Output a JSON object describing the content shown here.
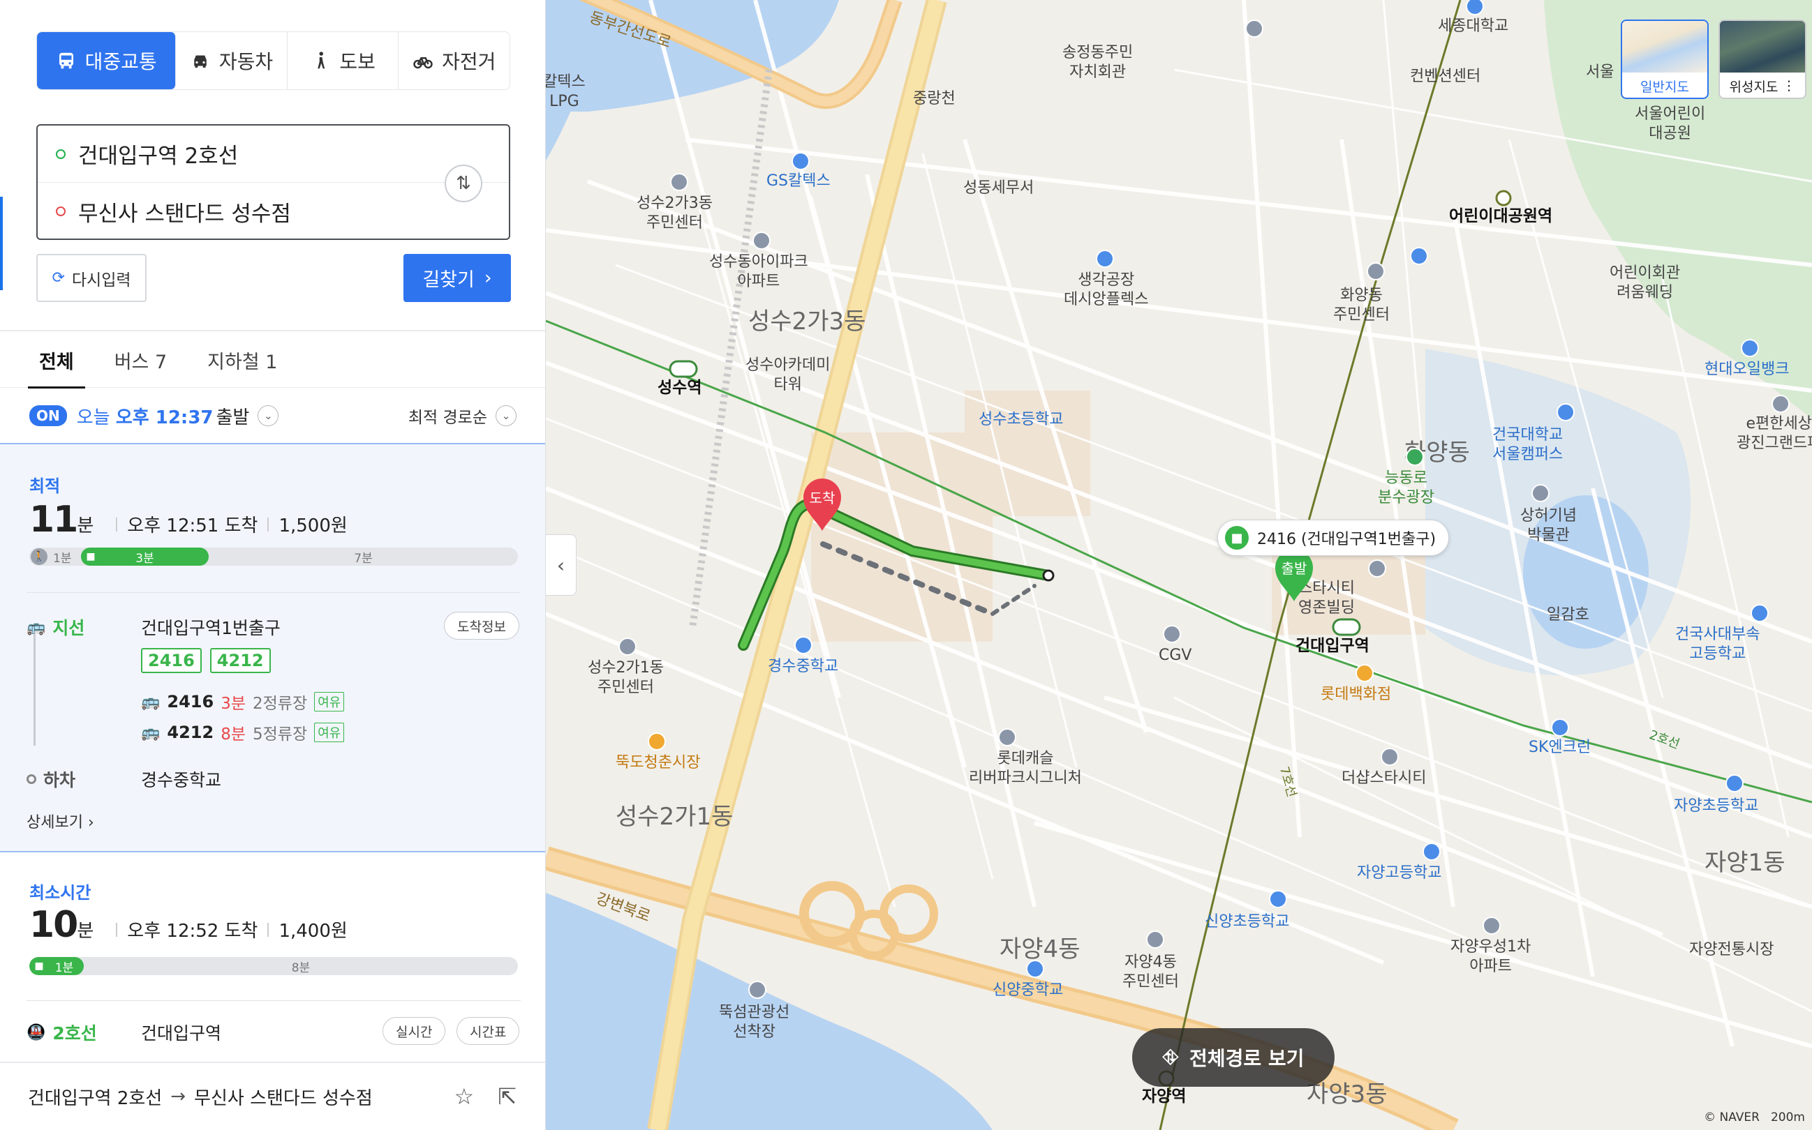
{
  "modes": [
    {
      "label": "대중교통",
      "icon": "bus-icon",
      "active": true
    },
    {
      "label": "자동차",
      "icon": "car-icon",
      "active": false
    },
    {
      "label": "도보",
      "icon": "walk-icon",
      "active": false
    },
    {
      "label": "자전거",
      "icon": "bicycle-icon",
      "active": false
    }
  ],
  "route": {
    "origin": "건대입구역 2호선",
    "destination": "무신사 스탠다드 성수점",
    "reset_label": "다시입력",
    "search_label": "길찾기"
  },
  "tabs": [
    "전체",
    "버스 7",
    "지하철 1"
  ],
  "timebar": {
    "badge": "ON",
    "prefix": "오늘",
    "time": "오후 12:37",
    "suffix": "출발",
    "sort_label": "최적 경로순"
  },
  "card1": {
    "label": "최적",
    "minutes": "11",
    "unit": "분",
    "arrival": "오후 12:51 도착",
    "fare": "1,500원",
    "bar": {
      "walk": "1분",
      "bus": "3분",
      "rest": "7분"
    },
    "step1": {
      "type": "지선",
      "stop": "건대입구역1번출구",
      "button": "도착정보",
      "buses": [
        "2416",
        "4212"
      ],
      "arrivals": [
        {
          "num": "2416",
          "min": "3분",
          "stops": "2정류장",
          "crowd": "여유"
        },
        {
          "num": "4212",
          "min": "8분",
          "stops": "5정류장",
          "crowd": "여유"
        }
      ]
    },
    "step2": {
      "type": "하차",
      "stop": "경수중학교"
    },
    "detail_link": "상세보기"
  },
  "card2": {
    "label": "최소시간",
    "minutes": "10",
    "unit": "분",
    "arrival": "오후 12:52 도착",
    "fare": "1,400원",
    "bar": {
      "subway": "1분",
      "rest": "8분"
    },
    "step1": {
      "type": "2호선",
      "stop": "건대입구역",
      "btn1": "실시간",
      "btn2": "시간표"
    }
  },
  "footer": {
    "from": "건대입구역 2호선",
    "to": "무신사 스탠다드 성수점"
  },
  "map": {
    "layers": [
      "일반지도",
      "위성지도"
    ],
    "bus_callout": "2416 (건대입구역1번출구)",
    "dest_pin": "도착",
    "start_pin": "출발",
    "full_route_label": "전체경로 보기",
    "copyright": "© NAVER",
    "scale": "200m",
    "labels": {
      "dongbu": "동부간선도로",
      "caltex_lpg": "칼텍스\nLPG",
      "jungnang": "중랑천",
      "songjeong": "송정동주민\n자치회관",
      "sejong": "세종대학교",
      "convention": "컨벤션센터",
      "seoul": "서울",
      "seoul_park": "서울어린이\n대공원",
      "gs": "GS칼텍스",
      "seongsu23_center": "성수2가3동\n주민센터",
      "seongdong_tax": "성동세무서",
      "ipark": "성수동아이파크\n아파트",
      "factory": "생각공장\n데시앙플렉스",
      "children_station": "어린이대공원역",
      "wedding": "어린이회관\n려움웨딩",
      "hwayang_center": "화양동\n주민센터",
      "seongsu23_dong": "성수2가3동",
      "academy": "성수아카데미\n타워",
      "seongsu_station": "성수역",
      "seongsu_elem": "성수초등학교",
      "hyundai_oil": "현대오일뱅크",
      "hwayang_dong": "화양동",
      "konkuk_seoul": "건국대학교\n서울캠퍼스",
      "e_pyeonhan": "e편한세상\n광진그랜드파",
      "neungdong": "능동로\n분수광장",
      "sanghuh": "상허기념\n박물관",
      "starcity": "스타시티\n영존빌딩",
      "ilgam": "일감호",
      "konkuk_station": "건대입구역",
      "cgv": "CGV",
      "lotte_dept": "롯데백화점",
      "konkuk_high": "건국사대부속\n고등학교",
      "seongsu21_center": "성수2가1동\n주민센터",
      "gyeongsu_middle": "경수중학교",
      "ttukdo_market": "뚝도청춘시장",
      "lotte_castle": "롯데캐슬\n리버파크시그니처",
      "the_shop": "더샵스타시티",
      "sk": "SK엔크린",
      "line2": "2호선",
      "line7": "7호선",
      "seongsu21_dong": "성수2가1동",
      "jayang_elem": "자양초등학교",
      "jayang_high": "자양고등학교",
      "jayang1": "자양1동",
      "gangbyeon": "강변북로",
      "sinyang_elem": "신양초등학교",
      "jayang_woosung": "자양우성1차\n아파트",
      "jayang_market": "자양전통시장",
      "jayang4": "자양4동",
      "jayang4_center": "자양4동\n주민센터",
      "sinyang_middle": "신양중학교",
      "ttukseom": "뚝섬관광선\n선착장",
      "jayang_station": "자양역",
      "jayang3": "자양3동"
    }
  }
}
